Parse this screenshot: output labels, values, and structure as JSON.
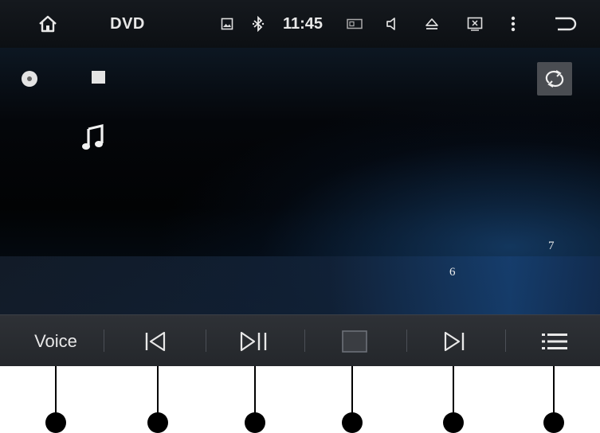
{
  "status_bar": {
    "title": "DVD",
    "time": "11:45",
    "icons": [
      "home-icon",
      "gallery-icon",
      "bluetooth-icon",
      "screen-icon",
      "volume-icon",
      "eject-icon",
      "display-toggle-icon",
      "more-vert-icon",
      "back-icon"
    ]
  },
  "main": {
    "disc_icon": "disc-icon",
    "play_state_icon": "stop-icon",
    "repeat_icon": "repeat-icon",
    "media_icon": "music-note-icon",
    "label_6": "6",
    "label_7": "7"
  },
  "controls": {
    "voice_label": "Voice",
    "buttons": [
      "voice",
      "previous",
      "play-pause",
      "stop",
      "next",
      "playlist"
    ]
  },
  "colors": {
    "status_bar_bg": "#12161b",
    "control_bar_bg": "#2a2d31",
    "accent_blue": "#1e5a9c",
    "icon_color": "#e8e8e8"
  }
}
